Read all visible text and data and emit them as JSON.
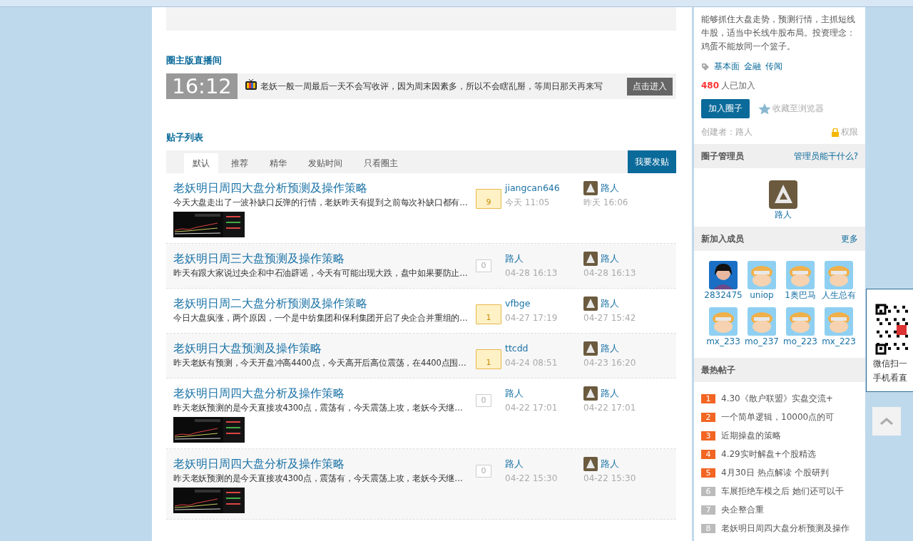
{
  "live": {
    "heading": "圈主版直播间",
    "time": "16:12",
    "message": "老妖一般一周最后一天不会写收评，因为周末因素多，所以不会瞎乱掰，等周日那天再来写",
    "button": "点击进入"
  },
  "posts": {
    "heading": "贴子列表",
    "tabs": [
      {
        "label": "默认",
        "selected": true
      },
      {
        "label": "推荐",
        "selected": false
      },
      {
        "label": "精华",
        "selected": false
      },
      {
        "label": "发贴时间",
        "selected": false
      },
      {
        "label": "只看圈主",
        "selected": false
      }
    ],
    "new_post_button": "我要发贴",
    "rows": [
      {
        "title": "老妖明日周四大盘分析预测及操作策略",
        "excerpt": "今天大盘走出了一波补缺口反弹的行情，老妖昨天有提到之前每次补缺口都有…",
        "replies": "9",
        "highlighted": true,
        "author": "jiangcan646",
        "posted": "今天 11:05",
        "last_user": "路人",
        "last_time": "昨天 16:06"
      },
      {
        "title": "老妖明日周三大盘预测及操作策略",
        "excerpt": "昨天有跟大家说过央企和中石油辟谣，今天有可能出现大跌，盘中如果要防止…",
        "replies": "0",
        "highlighted": false,
        "author": "路人",
        "posted": "04-28 16:13",
        "last_user": "路人",
        "last_time": "04-28 16:13"
      },
      {
        "title": "老妖明日周二大盘分析预测及操作策略",
        "excerpt": "今日大盘疯涨，两个原因，一个是中纺集团和保利集团开启了央企合并重组的…",
        "replies": "1",
        "highlighted": true,
        "author": "vfbge",
        "posted": "04-27 17:19",
        "last_user": "路人",
        "last_time": "04-27 15:42"
      },
      {
        "title": "老妖明日大盘预测及操作策略",
        "excerpt": "昨天老妖有预测，今天开盘冲高4400点，今天高开后高位震荡，在4400点围…",
        "replies": "1",
        "highlighted": true,
        "author": "ttcdd",
        "posted": "04-24 08:51",
        "last_user": "路人",
        "last_time": "04-23 16:20"
      },
      {
        "title": "老妖明日周四大盘分析及操作策略",
        "excerpt": "昨天老妖预测的是今天直接攻4300点，震荡有，今天震荡上攻，老妖今天继…",
        "replies": "0",
        "highlighted": false,
        "author": "路人",
        "posted": "04-22 17:01",
        "last_user": "路人",
        "last_time": "04-22 17:01"
      },
      {
        "title": "老妖明日周四大盘分析及操作策略",
        "excerpt": "昨天老妖预测的是今天直接攻4300点，震荡有，今天震荡上攻，老妖今天继…",
        "replies": "0",
        "highlighted": false,
        "author": "路人",
        "posted": "04-22 15:30",
        "last_user": "路人",
        "last_time": "04-22 15:30"
      }
    ]
  },
  "sidebar": {
    "intro": "能够抓住大盘走势，预测行情，主抓短线牛股，适当中长线牛股布局。投资理念：鸡蛋不能放同一个篮子。",
    "tags": [
      "基本面",
      "金融",
      "传闻"
    ],
    "member_count": "480",
    "member_label": "人已加入",
    "join_button": "加入圈子",
    "favorite_link": "收藏至浏览器",
    "creator": "创建者：路人",
    "permission_link": "权限",
    "admins": {
      "heading": "圈子管理员",
      "link": "管理员能干什么?",
      "members": [
        {
          "name": "路人",
          "kind": "rock"
        }
      ]
    },
    "new_members": {
      "heading": "新加入成员",
      "link": "更多",
      "members": [
        {
          "name": "2832475",
          "kind": "person"
        },
        {
          "name": "uniop",
          "kind": "cartoon"
        },
        {
          "name": "1奥巴马",
          "kind": "cartoon"
        },
        {
          "name": "人生总有",
          "kind": "cartoon"
        },
        {
          "name": "mx_233",
          "kind": "cartoon"
        },
        {
          "name": "mo_237",
          "kind": "cartoon"
        },
        {
          "name": "mo_223",
          "kind": "cartoon"
        },
        {
          "name": "mx_223",
          "kind": "cartoon"
        }
      ]
    },
    "hot_posts": {
      "heading": "最热帖子",
      "items": [
        {
          "rank": "1",
          "title": "4.30《散户联盟》实盘交流+",
          "highlighted": true
        },
        {
          "rank": "2",
          "title": "一个简单逻辑，10000点的可",
          "highlighted": true
        },
        {
          "rank": "3",
          "title": "近期操盘的策略",
          "highlighted": true
        },
        {
          "rank": "4",
          "title": "4.29实时解盘+个股精选",
          "highlighted": true
        },
        {
          "rank": "5",
          "title": "4月30日 热点解读 个股研判",
          "highlighted": true
        },
        {
          "rank": "6",
          "title": "车展拒绝车模之后 她们还可以干",
          "highlighted": false
        },
        {
          "rank": "7",
          "title": "央企整合重",
          "highlighted": false
        },
        {
          "rank": "8",
          "title": "老妖明日周四大盘分析预测及操作",
          "highlighted": false
        }
      ]
    }
  },
  "qr_panel": {
    "line_1": "微信扫一",
    "line_2": "手机看直"
  }
}
